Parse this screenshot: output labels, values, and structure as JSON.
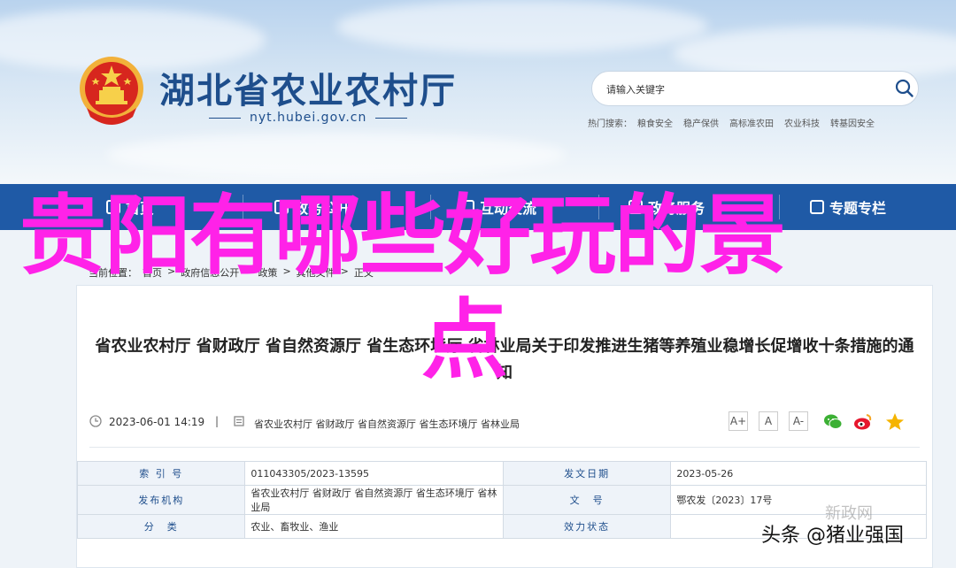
{
  "header": {
    "site_title": "湖北省农业农村厅",
    "site_url": "nyt.hubei.gov.cn",
    "search": {
      "placeholder": "请输入关键字"
    },
    "hot_search": {
      "label": "热门搜索：",
      "items": [
        "粮食安全",
        "稳产保供",
        "高标准农田",
        "农业科技",
        "转基因安全"
      ]
    }
  },
  "nav": {
    "items": [
      {
        "label": "首页",
        "icon": "home-icon"
      },
      {
        "label": "政务公开",
        "icon": "document-icon"
      },
      {
        "label": "互动交流",
        "icon": "chat-icon"
      },
      {
        "label": "政务服务",
        "icon": "service-icon"
      },
      {
        "label": "专题专栏",
        "icon": "column-icon"
      }
    ]
  },
  "breadcrumb": {
    "items": [
      "当前位置：",
      "首页",
      ">",
      "政府信息公开",
      ">",
      "政策",
      ">",
      "其他文件",
      ">",
      "正文"
    ]
  },
  "article": {
    "title": "省农业农村厅 省财政厅 省自然资源厅 省生态环境厅 省林业局关于印发推进生猪等养殖业稳增长促增收十条措施的通知",
    "date": "2023-06-01 14:19",
    "meta_separator": "|",
    "sources": "省农业农村厅 省财政厅 省自然资源厅 省生态环境厅 省林业局",
    "font_buttons": [
      "A+",
      "A",
      "A-"
    ],
    "share_icons": [
      "wechat-icon",
      "weibo-icon",
      "favorite-icon"
    ]
  },
  "info_table": {
    "rows": [
      {
        "label1": "索 引 号",
        "value1": "011043305/2023-13595",
        "label2": "发文日期",
        "value2": "2023-05-26"
      },
      {
        "label1": "发布机构",
        "value1": "省农业农村厅 省财政厅 省自然资源厅 省生态环境厅 省林业局",
        "label2": "文　号",
        "value2": "鄂农发〔2023〕17号"
      },
      {
        "label1": "分　类",
        "value1": "农业、畜牧业、渔业",
        "label2": "效力状态",
        "value2": ""
      }
    ]
  },
  "overlay": {
    "line1": "贵阳有哪些好玩的景",
    "line2": "点"
  },
  "watermark": {
    "faint": "新政网",
    "text": "头条 @猪业强国"
  },
  "colors": {
    "brand_blue": "#1e4e8c",
    "nav_blue": "#1f5aa6",
    "overlay_magenta": "#ff22e8"
  }
}
